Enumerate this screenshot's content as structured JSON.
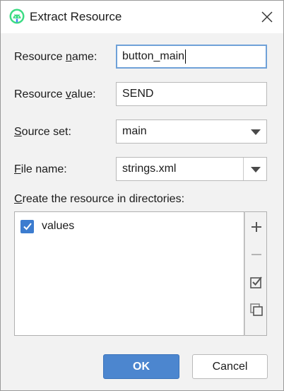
{
  "window": {
    "title": "Extract Resource"
  },
  "form": {
    "resource_name": {
      "label_pre": "Resource ",
      "label_mnemonic": "n",
      "label_post": "ame:",
      "value": "button_main"
    },
    "resource_value": {
      "label_pre": "Resource ",
      "label_mnemonic": "v",
      "label_post": "alue:",
      "value": "SEND"
    },
    "source_set": {
      "label_pre": "",
      "label_mnemonic": "S",
      "label_post": "ource set:",
      "value": "main"
    },
    "file_name": {
      "label_pre": "",
      "label_mnemonic": "F",
      "label_post": "ile name:",
      "value": "strings.xml"
    }
  },
  "directories": {
    "label_pre": "",
    "label_mnemonic": "C",
    "label_post": "reate the resource in directories:",
    "items": [
      {
        "label": "values",
        "checked": true
      }
    ]
  },
  "buttons": {
    "ok": "OK",
    "cancel": "Cancel"
  },
  "icons": {
    "app": "android-studio-icon",
    "close": "close-icon",
    "add": "plus-icon",
    "remove": "minus-icon",
    "select_all": "checklist-icon",
    "copy": "copy-icon"
  },
  "colors": {
    "accent": "#4c86cf",
    "checkbox": "#3c7ccf",
    "focus_border": "#6fa1d8"
  }
}
